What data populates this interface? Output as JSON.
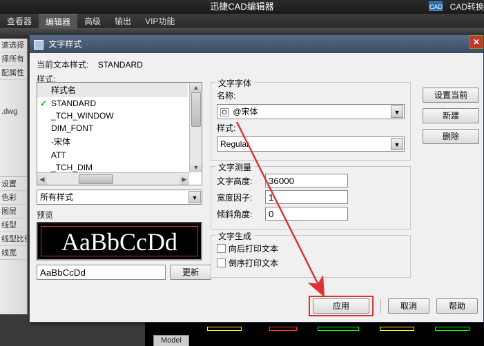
{
  "app": {
    "title": "迅捷CAD编辑器",
    "cad_icon_text": "CAD",
    "cad_convert": "CAD转换"
  },
  "tabs": {
    "viewer": "查看器",
    "editor": "编辑器",
    "advanced": "高级",
    "output": "输出",
    "vip": "VIP功能"
  },
  "side": {
    "items": [
      "速选择",
      "择所有",
      "配属性"
    ],
    "file": ".dwg",
    "accord": [
      "设置",
      "色彩",
      "图层",
      "线型",
      "线型比例",
      "线宽"
    ]
  },
  "dialog": {
    "title": "文字样式",
    "current_label": "当前文本样式:",
    "current_value": "STANDARD",
    "styles_label": "样式:",
    "style_header": "样式名",
    "styles": [
      "STANDARD",
      "_TCH_WINDOW",
      "DIM_FONT",
      "-宋体",
      "ATT",
      "_TCH_DIM"
    ],
    "filter": "所有样式",
    "preview_label": "预览",
    "preview_text": "AaBbCcDd",
    "preview_input": "AaBbCcDd",
    "update_btn": "更新",
    "font_group": "文字字体",
    "font_name_label": "名称:",
    "font_name_value": "@宋体",
    "font_style_label": "样式:",
    "font_style_value": "Regular",
    "measure_group": "文字测量",
    "height_label": "文字高度:",
    "height_value": "36000",
    "width_label": "宽度因子:",
    "width_value": "1",
    "oblique_label": "倾斜角度:",
    "oblique_value": "0",
    "gen_group": "文字生成",
    "backward": "向后打印文本",
    "upside": "倒序打印文本",
    "set_current": "设置当前",
    "new": "新建",
    "delete": "删除",
    "apply": "应用",
    "cancel": "取消",
    "help": "帮助"
  },
  "cad": {
    "model_tab": "Model"
  }
}
